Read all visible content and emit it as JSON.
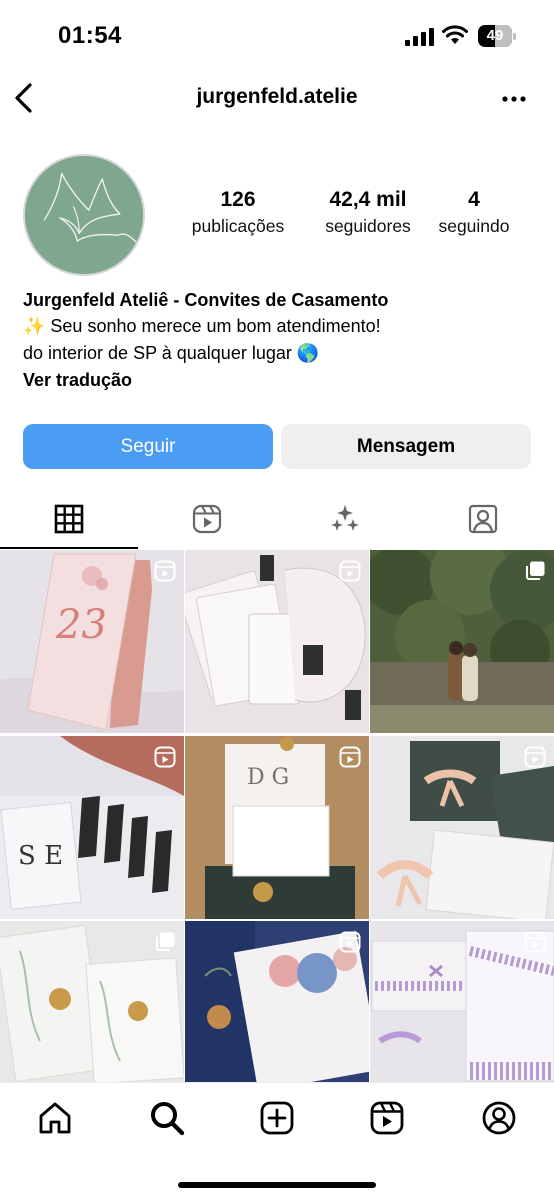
{
  "status_bar": {
    "time": "01:54",
    "battery_level": "49",
    "battery_fraction": 0.49
  },
  "header": {
    "username": "jurgenfeld.atelie"
  },
  "profile": {
    "stats": [
      {
        "value": "126",
        "label": "publicações"
      },
      {
        "value": "42,4 mil",
        "label": "seguidores"
      },
      {
        "value": "4",
        "label": "seguindo"
      }
    ],
    "name": "Jurgenfeld Ateliê - Convites de Casamento",
    "bio_line1": "✨ Seu sonho merece um bom atendimento!",
    "bio_line2": "do interior de SP à qualquer lugar 🌎",
    "translate_link": "Ver tradução"
  },
  "actions": {
    "follow_label": "Seguir",
    "message_label": "Mensagem"
  },
  "tabs": [
    {
      "name": "grid-icon",
      "active": true
    },
    {
      "name": "reels-icon",
      "active": false
    },
    {
      "name": "sparkles-icon",
      "active": false
    },
    {
      "name": "tagged-icon",
      "active": false
    }
  ],
  "posts": [
    {
      "type": "reel",
      "handwritten": "23"
    },
    {
      "type": "reel"
    },
    {
      "type": "carousel"
    },
    {
      "type": "reel",
      "letters": "S E"
    },
    {
      "type": "reel",
      "letters": "D G"
    },
    {
      "type": "reel"
    },
    {
      "type": "carousel"
    },
    {
      "type": "reel"
    },
    {
      "type": "reel"
    }
  ],
  "bottom_nav": [
    {
      "name": "home-icon"
    },
    {
      "name": "search-icon",
      "active": true
    },
    {
      "name": "create-icon"
    },
    {
      "name": "reels-nav-icon"
    },
    {
      "name": "profile-nav-icon"
    }
  ],
  "colors": {
    "follow_button": "#4a9df2",
    "message_button": "#efefef",
    "avatar_bg": "#7fa68f"
  }
}
